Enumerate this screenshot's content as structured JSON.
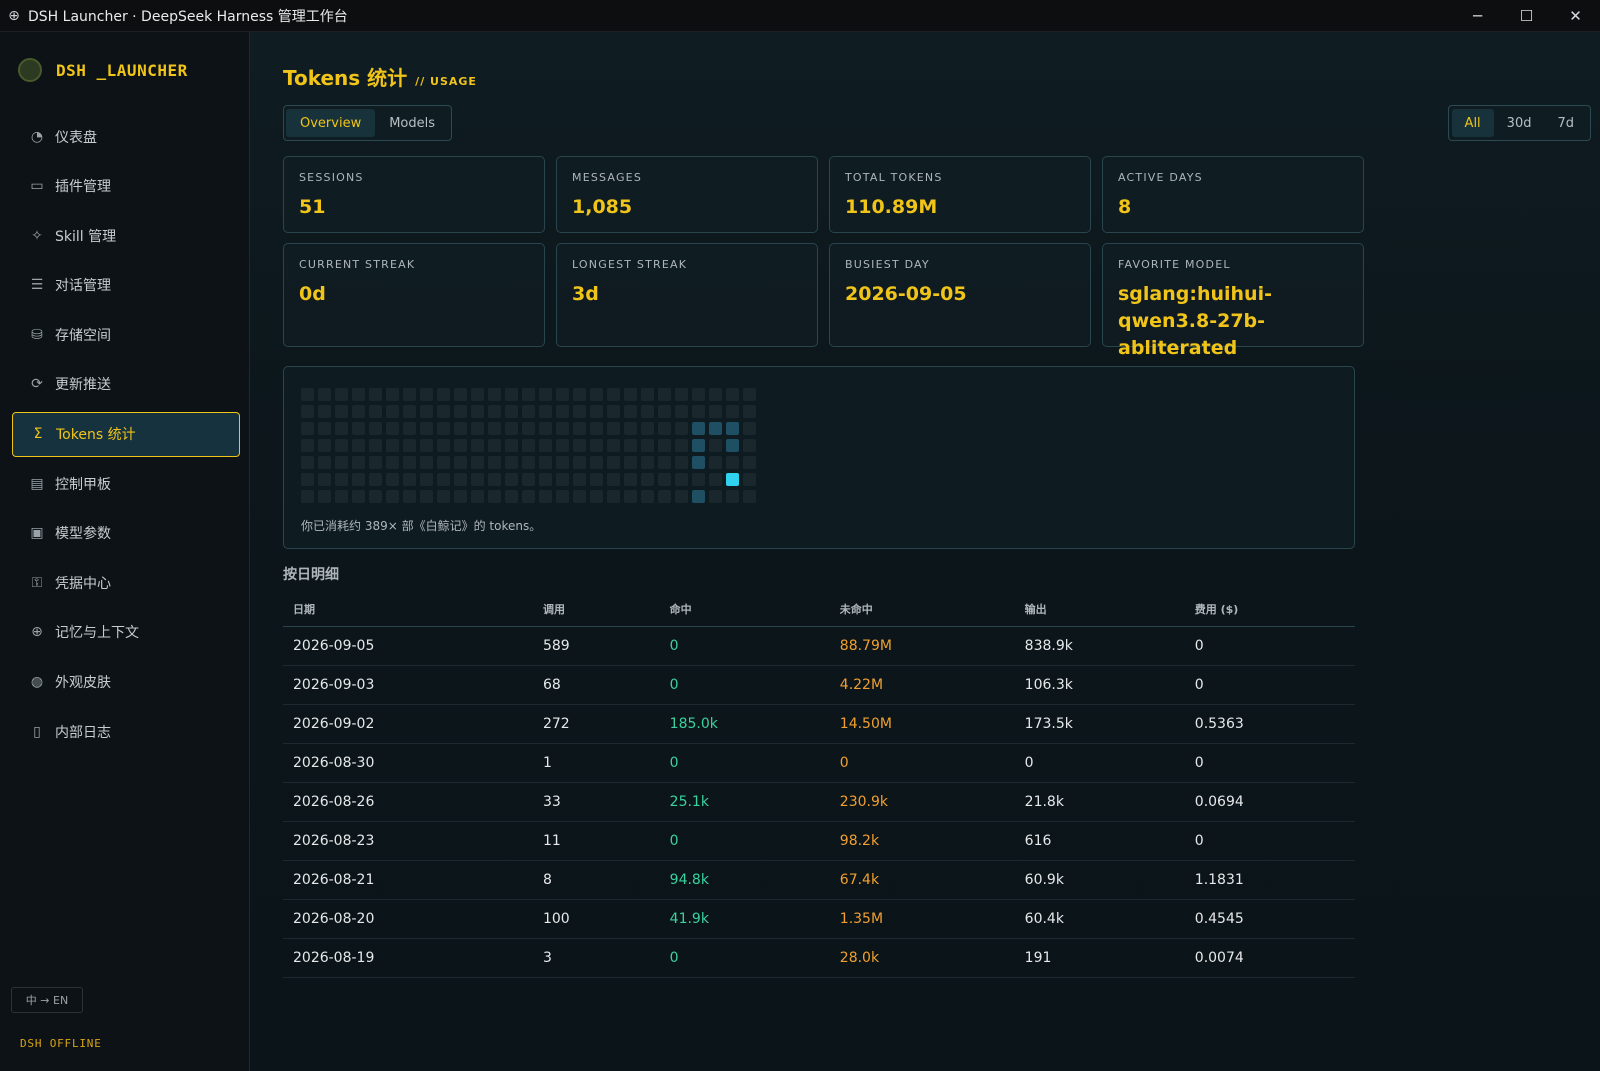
{
  "window": {
    "title": "DSH Launcher · DeepSeek Harness 管理工作台",
    "minimize": "─",
    "maximize": "☐",
    "close": "✕"
  },
  "sidebar": {
    "brand": "DSH _LAUNCHER",
    "items": [
      {
        "label": "仪表盘",
        "icon": "◔"
      },
      {
        "label": "插件管理",
        "icon": "▭"
      },
      {
        "label": "Skill 管理",
        "icon": "✧"
      },
      {
        "label": "对话管理",
        "icon": "☰"
      },
      {
        "label": "存储空间",
        "icon": "⛁"
      },
      {
        "label": "更新推送",
        "icon": "⟳"
      },
      {
        "label": "Tokens 统计",
        "icon": "Σ"
      },
      {
        "label": "控制甲板",
        "icon": "▤"
      },
      {
        "label": "模型参数",
        "icon": "▣"
      },
      {
        "label": "凭据中心",
        "icon": "⚿"
      },
      {
        "label": "记忆与上下文",
        "icon": "⊕"
      },
      {
        "label": "外观皮肤",
        "icon": "◍"
      },
      {
        "label": "内部日志",
        "icon": "▯"
      }
    ],
    "active_index": 6,
    "lang_toggle": "中 → EN",
    "status": "DSH OFFLINE"
  },
  "page": {
    "title": "Tokens 统计",
    "subtitle": "// USAGE",
    "tabs": [
      "Overview",
      "Models"
    ],
    "active_tab": 0,
    "ranges": [
      "All",
      "30d",
      "7d"
    ],
    "active_range": 0
  },
  "stats": [
    {
      "label": "SESSIONS",
      "value": "51"
    },
    {
      "label": "MESSAGES",
      "value": "1,085"
    },
    {
      "label": "TOTAL TOKENS",
      "value": "110.89M"
    },
    {
      "label": "ACTIVE DAYS",
      "value": "8"
    },
    {
      "label": "CURRENT STREAK",
      "value": "0d"
    },
    {
      "label": "LONGEST STREAK",
      "value": "3d"
    },
    {
      "label": "BUSIEST DAY",
      "value": "2026-09-05"
    },
    {
      "label": "FAVORITE MODEL",
      "value": "sglang:huihui-qwen3.8-27b-abliterated"
    }
  ],
  "heatmap": {
    "caption": "你已消耗约 389× 部《白鲸记》的 tokens。",
    "weeks": 27,
    "days": 7,
    "active_cells": [
      {
        "week": 23,
        "day": 2,
        "level": 1
      },
      {
        "week": 24,
        "day": 2,
        "level": 1
      },
      {
        "week": 25,
        "day": 2,
        "level": 1
      },
      {
        "week": 23,
        "day": 3,
        "level": 1
      },
      {
        "week": 25,
        "day": 3,
        "level": 1
      },
      {
        "week": 23,
        "day": 4,
        "level": 1
      },
      {
        "week": 25,
        "day": 5,
        "level": 3
      },
      {
        "week": 23,
        "day": 6,
        "level": 1
      }
    ],
    "colors": {
      "empty": "#1a272c",
      "low": "#1e4f63",
      "high": "#2fd3f0"
    }
  },
  "daily": {
    "title": "按日明细",
    "columns": [
      "日期",
      "调用",
      "命中",
      "未命中",
      "输出",
      "费用 ($)"
    ],
    "rows": [
      [
        "2026-09-05",
        "589",
        "0",
        "88.79M",
        "838.9k",
        "0"
      ],
      [
        "2026-09-03",
        "68",
        "0",
        "4.22M",
        "106.3k",
        "0"
      ],
      [
        "2026-09-02",
        "272",
        "185.0k",
        "14.50M",
        "173.5k",
        "0.5363"
      ],
      [
        "2026-08-30",
        "1",
        "0",
        "0",
        "0",
        "0"
      ],
      [
        "2026-08-26",
        "33",
        "25.1k",
        "230.9k",
        "21.8k",
        "0.0694"
      ],
      [
        "2026-08-23",
        "11",
        "0",
        "98.2k",
        "616",
        "0"
      ],
      [
        "2026-08-21",
        "8",
        "94.8k",
        "67.4k",
        "60.9k",
        "1.1831"
      ],
      [
        "2026-08-20",
        "100",
        "41.9k",
        "1.35M",
        "60.4k",
        "0.4545"
      ],
      [
        "2026-08-19",
        "3",
        "0",
        "28.0k",
        "191",
        "0.0074"
      ]
    ]
  }
}
